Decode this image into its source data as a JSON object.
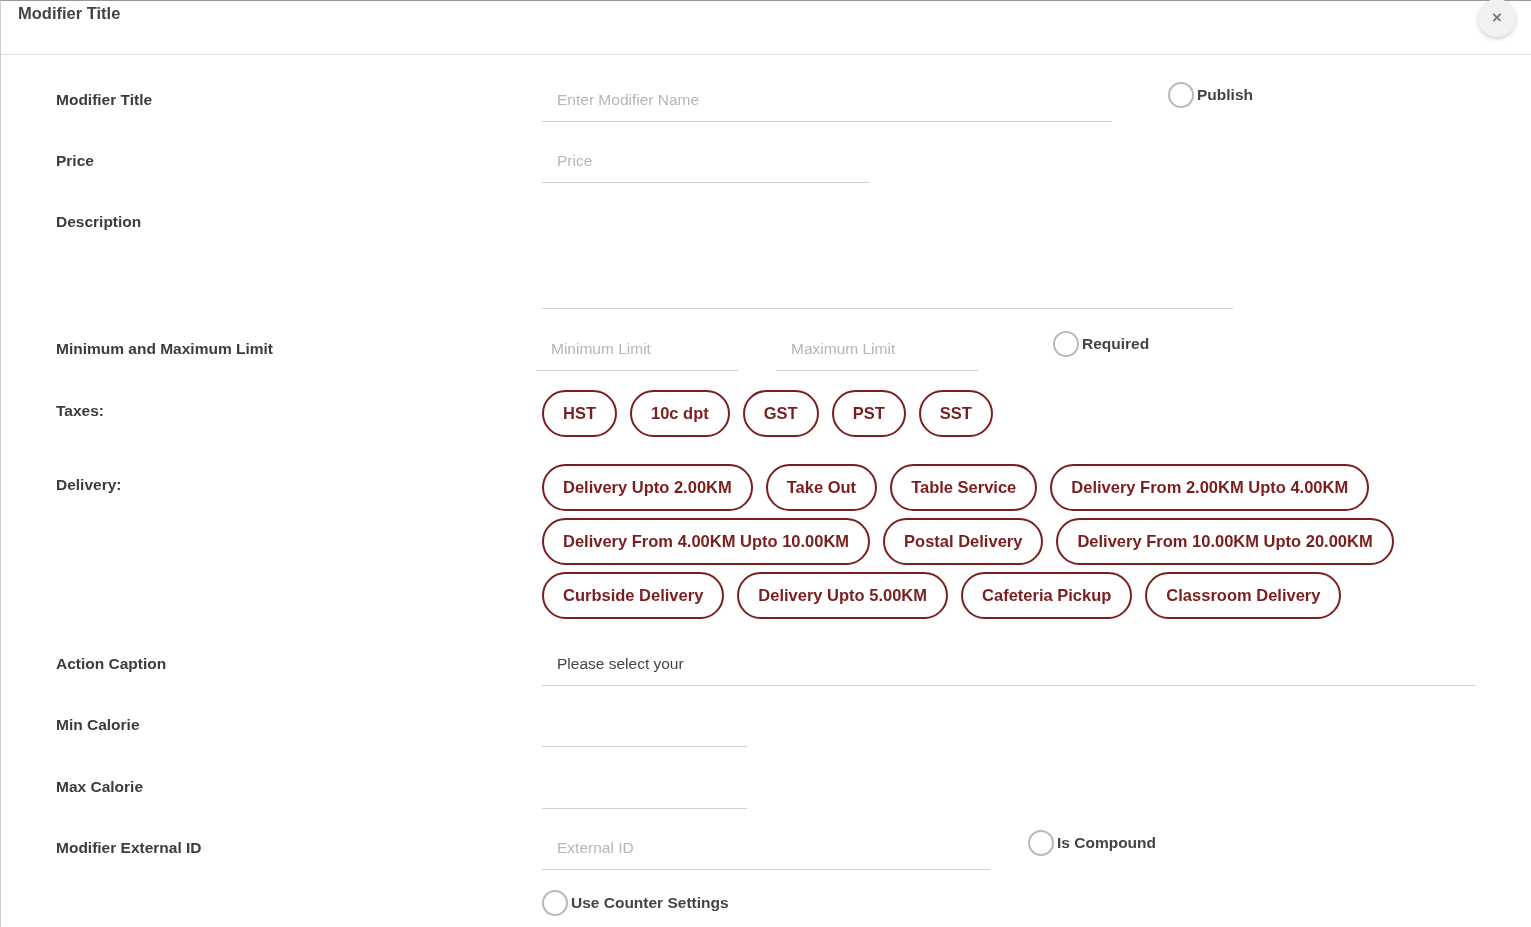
{
  "header": {
    "title": "Modifier Title",
    "close": "×"
  },
  "rows": [
    {
      "kind": "text",
      "label": "Modifier Title",
      "placeholder": "Enter Modifier Name",
      "option": {
        "label": "Publish",
        "checked": false
      }
    },
    {
      "kind": "text",
      "label": "Price",
      "placeholder": "Price"
    },
    {
      "kind": "textarea",
      "label": "Description"
    },
    {
      "kind": "pair",
      "label": "Minimum and Maximum Limit",
      "placeholders": [
        "Minimum Limit",
        "Maximum Limit"
      ],
      "option": {
        "label": "Required",
        "checked": false
      }
    },
    {
      "kind": "chips",
      "label": "Taxes:",
      "chips": [
        "HST",
        "10c dpt",
        "GST",
        "PST",
        "SST"
      ]
    },
    {
      "kind": "chips",
      "label": "Delivery:",
      "chips": [
        "Delivery Upto 2.00KM",
        "Take Out",
        "Table Service",
        "Delivery From 2.00KM Upto 4.00KM",
        "Delivery From 4.00KM Upto 10.00KM",
        "Postal Delivery",
        "Delivery From 10.00KM Upto 20.00KM",
        "Curbside Delivery",
        "Delivery Upto 5.00KM",
        "Cafeteria Pickup",
        "Classroom Delivery"
      ]
    },
    {
      "kind": "text",
      "label": "Action Caption",
      "value": "Please select your"
    },
    {
      "kind": "text",
      "label": "Min Calorie"
    },
    {
      "kind": "text",
      "label": "Max Calorie"
    },
    {
      "kind": "text",
      "label": "Modifier External ID",
      "placeholder": "External ID",
      "option": {
        "label": "Is Compound",
        "checked": false
      }
    },
    {
      "kind": "check",
      "option": {
        "label": "Use Counter Settings",
        "checked": false
      }
    }
  ]
}
